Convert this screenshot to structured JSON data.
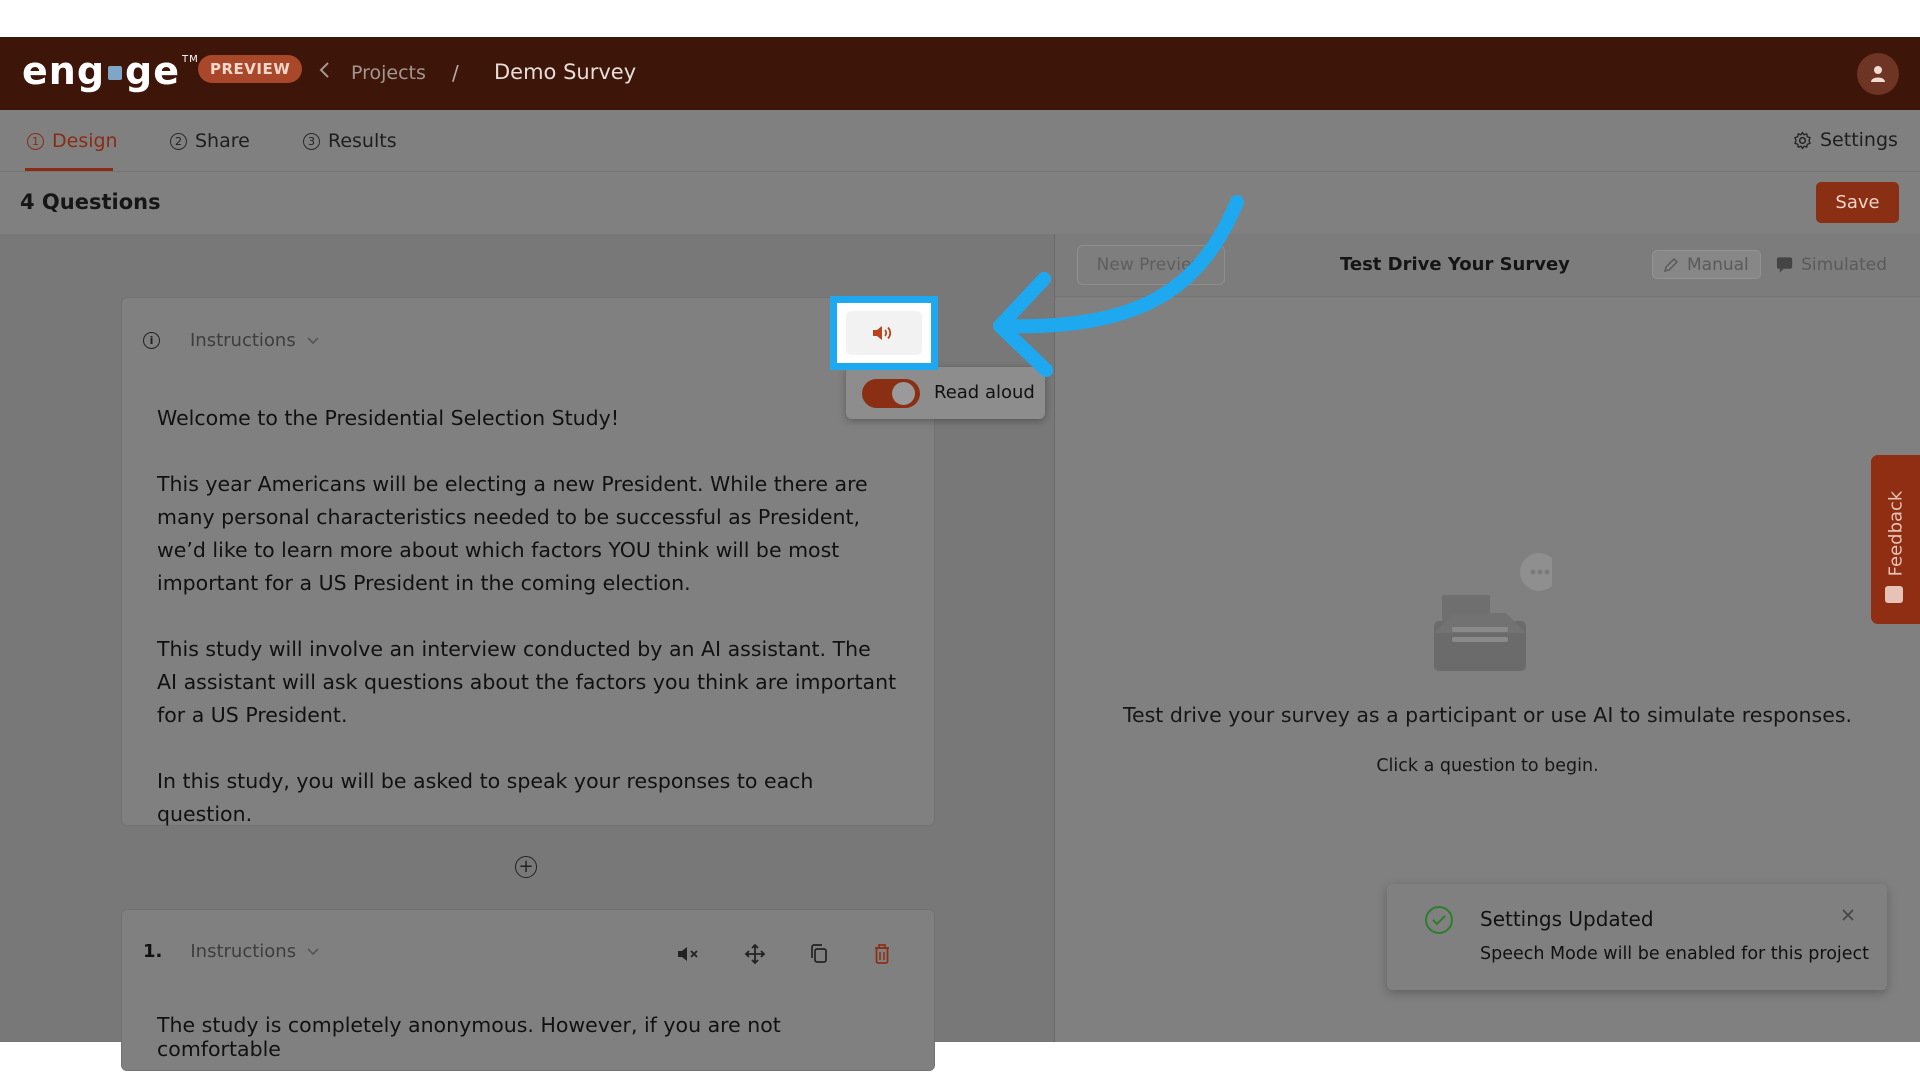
{
  "app": {
    "logo_text": "engage",
    "preview_badge": "PREVIEW"
  },
  "breadcrumb": {
    "projects": "Projects",
    "separator": "/",
    "current": "Demo Survey"
  },
  "tabs": [
    {
      "num": "1",
      "label": "Design",
      "active": true
    },
    {
      "num": "2",
      "label": "Share",
      "active": false
    },
    {
      "num": "3",
      "label": "Results",
      "active": false
    }
  ],
  "settings_label": "Settings",
  "questions_count": "4 Questions",
  "save_label": "Save",
  "card1": {
    "type_label": "Instructions",
    "paragraphs": [
      "Welcome to the Presidential Selection Study!",
      "This year Americans will be electing a new President. While there are many personal characteristics needed to be successful as President, we’d like to learn more about which factors YOU think will be most important for a US President in the coming election.",
      "This study will involve an interview conducted by an AI assistant. The AI assistant will ask questions about the factors you think are important for a US President.",
      "In this study, you will be asked to speak your responses to each question."
    ]
  },
  "card2": {
    "number": "1.",
    "type_label": "Instructions",
    "text": "The study is completely anonymous. However, if you are not comfortable"
  },
  "read_aloud": {
    "label": "Read aloud",
    "enabled": true
  },
  "preview_panel": {
    "new_preview_label": "New Preview",
    "title": "Test Drive Your Survey",
    "manual_label": "Manual",
    "simulated_label": "Simulated",
    "empty_text": "Test drive your survey as a participant or use AI to simulate responses.",
    "empty_subtext": "Click a question to begin."
  },
  "feedback_label": "Feedback",
  "toast": {
    "title": "Settings Updated",
    "message": "Speech Mode will be enabled for this project"
  },
  "colors": {
    "brand": "#3d1509",
    "accent": "#8b2f14",
    "highlight": "#1ea8f0",
    "success": "#2d7d2d"
  }
}
